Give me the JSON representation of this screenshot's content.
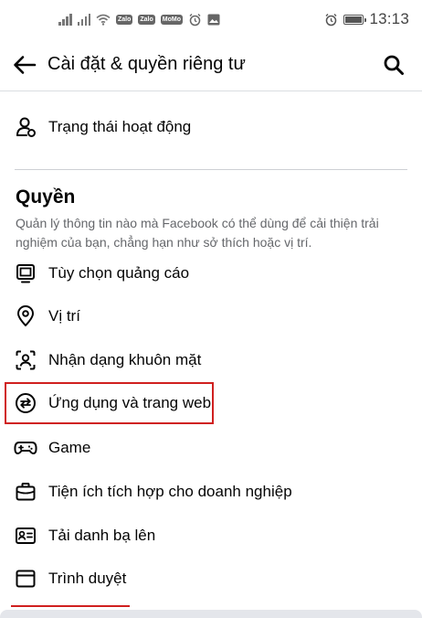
{
  "status_bar": {
    "time": "13:13",
    "badges": [
      "Zalo",
      "Zalo",
      "MoMo"
    ]
  },
  "header": {
    "title": "Cài đặt & quyền riêng tư",
    "back_icon": "arrow-left-icon",
    "search_icon": "search-icon"
  },
  "activity": {
    "label": "Trạng thái hoạt động",
    "icon": "person-status-icon"
  },
  "permissions": {
    "title": "Quyền",
    "description": "Quản lý thông tin nào mà Facebook có thể dùng để cải thiện trải nghiệm của bạn, chẳng hạn như sở thích hoặc vị trí.",
    "items": [
      {
        "label": "Tùy chọn quảng cáo",
        "icon": "monitor-icon"
      },
      {
        "label": "Vị trí",
        "icon": "location-pin-icon"
      },
      {
        "label": "Nhận dạng khuôn mặt",
        "icon": "face-scan-icon"
      },
      {
        "label": "Ứng dụng và trang web",
        "icon": "swap-arrows-icon",
        "highlighted": true
      },
      {
        "label": "Game",
        "icon": "gamepad-icon"
      },
      {
        "label": "Tiện ích tích hợp cho doanh nghiệp",
        "icon": "briefcase-icon"
      },
      {
        "label": "Tải danh bạ lên",
        "icon": "contact-card-icon"
      },
      {
        "label": "Trình duyệt",
        "icon": "browser-window-icon"
      }
    ]
  },
  "colors": {
    "highlight": "#d0201f",
    "text_primary": "#050505",
    "text_secondary": "#65676b",
    "divider": "#ced0d4"
  }
}
